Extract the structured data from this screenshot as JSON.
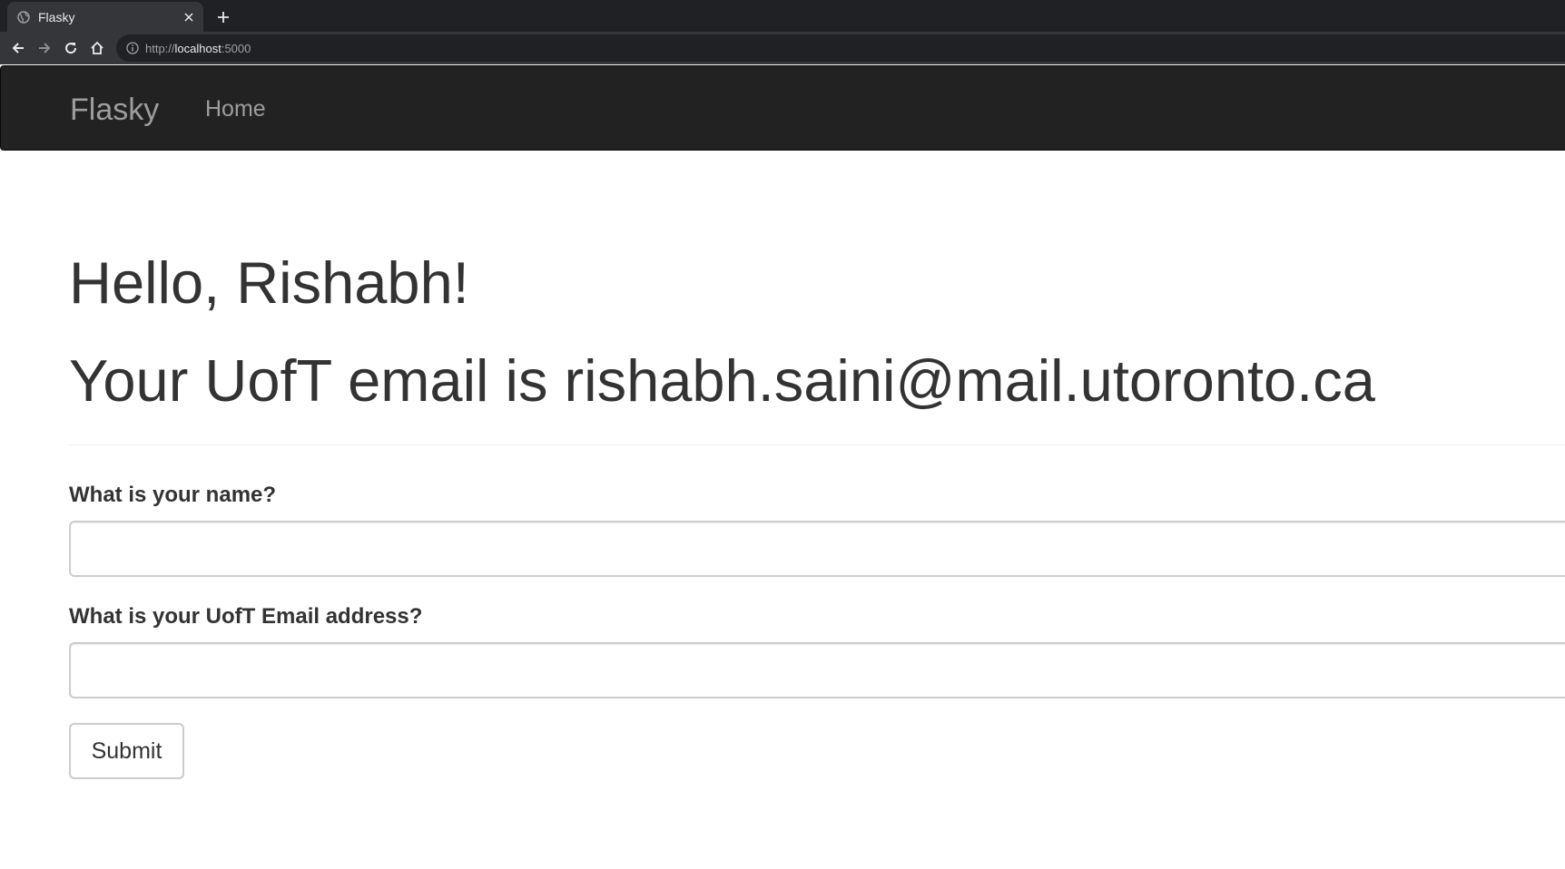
{
  "browser": {
    "tab_title": "Flasky",
    "tab_icon": "globe-icon",
    "url_scheme": "http://",
    "url_host": "localhost",
    "url_port": ":5000"
  },
  "navbar": {
    "brand": "Flasky",
    "items": [
      {
        "label": "Home"
      }
    ]
  },
  "main": {
    "greeting": "Hello, Rishabh!",
    "email_line": "Your UofT email is rishabh.saini@mail.utoronto.ca"
  },
  "form": {
    "name_label": "What is your name?",
    "name_value": "",
    "email_label": "What is your UofT Email address?",
    "email_value": "",
    "submit_label": "Submit"
  },
  "colors": {
    "navbar_bg": "#222222",
    "navbar_text": "#9d9d9d",
    "body_text": "#333333",
    "input_border": "#cccccc"
  }
}
